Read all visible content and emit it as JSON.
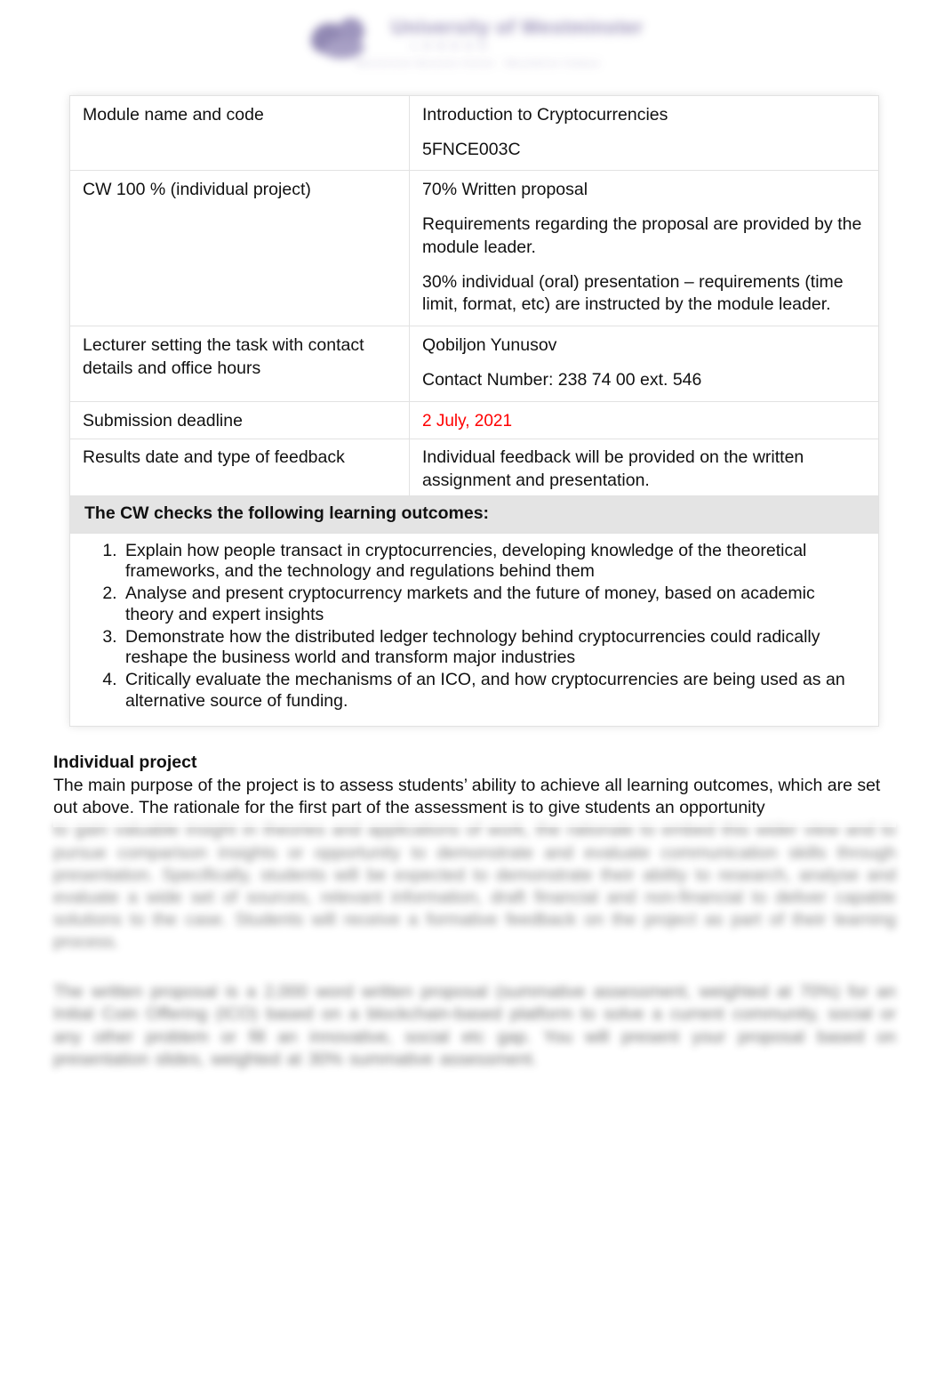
{
  "header": {
    "logo_icon": "university-crest-logo",
    "wordmark": "University of Westminster",
    "sub_wordmark": "L O N D O N",
    "strapline": "Westminster Business School  ·  Marylebone Campus"
  },
  "table": {
    "rows": [
      {
        "id": "module",
        "label": "Module name and code",
        "values": [
          "Introduction to Cryptocurrencies",
          "5FNCE003C"
        ]
      },
      {
        "id": "coursework",
        "label": "CW 100 % (individual project)",
        "values": [
          "70% Written proposal",
          "Requirements regarding the proposal are provided by the module leader.",
          "30% individual (oral) presentation – requirements (time limit, format, etc) are instructed by the module leader."
        ]
      },
      {
        "id": "lecturer",
        "label": "Lecturer setting the task with contact details and office hours",
        "values": [
          "Qobiljon Yunusov",
          "Contact Number: 238 74 00 ext. 546"
        ]
      },
      {
        "id": "deadline",
        "label": "Submission deadline",
        "values": [
          "2 July, 2021"
        ],
        "value_color": "#ff0000"
      },
      {
        "id": "results",
        "label": "Results date and type of feedback",
        "values": [
          "Individual feedback will be provided on the written assignment and presentation."
        ]
      }
    ],
    "outcomes_heading": "The CW checks the following learning outcomes:",
    "outcomes": [
      "Explain how people transact in cryptocurrencies, developing knowledge of the theoretical frameworks, and the technology and regulations behind them",
      "Analyse and present cryptocurrency markets and the future of money, based on academic theory and expert insights",
      "Demonstrate how the distributed ledger technology behind cryptocurrencies could radically reshape the business world and transform major industries",
      "Critically evaluate the mechanisms of an ICO, and how cryptocurrencies are being used as an alternative source of funding."
    ],
    "header_row_bg": "#e4e4e4",
    "border_color": "#e2e2e2"
  },
  "body": {
    "section_title": "Individual project",
    "intro": "The main purpose of the project is to assess students’ ability to achieve all learning outcomes, which are set out above. The rationale for the first part of the assessment is to give students an opportunity",
    "blurred_paragraph_1": "to gain valuable insight in theories and applications of work, the rationale to embed this wider view and to pursue comparison insights or opportunity to demonstrate and evaluate communication skills through presentation. Specifically, students will be expected to demonstrate their ability to research, analyse and evaluate a wide set of sources, relevant information, draft financial and non-financial to deliver capable solutions to the case. Students will receive a formative feedback on the project as part of their learning process.",
    "blurred_paragraph_2": "The written proposal is a 2,000 word written proposal (summative assessment, weighted at 70%) for an Initial Coin Offering (ICO) based on a blockchain-based platform to solve a current community, social or any other problem or fill an innovative, social etc gap. You will present your proposal based on presentation slides, weighted at 30% summative assessment."
  }
}
